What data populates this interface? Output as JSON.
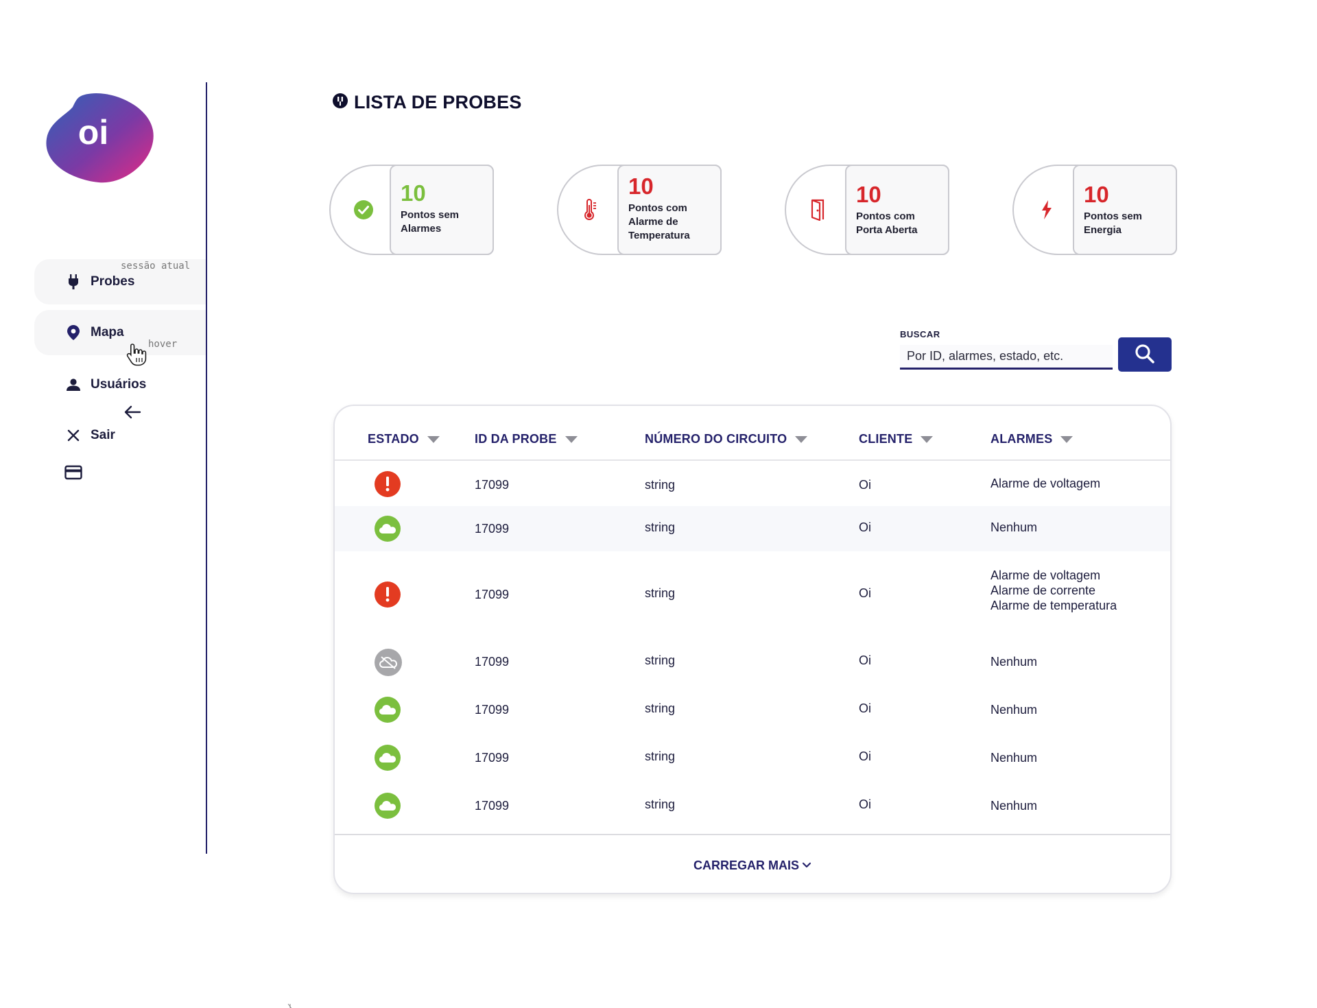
{
  "logo": {
    "text": "oi",
    "colors": [
      "#2f62b8",
      "#7b3aa5",
      "#e52a84"
    ]
  },
  "sidebar": {
    "current_session_note": "sessão atual",
    "hover_note": "hover",
    "items": [
      {
        "label": "Probes",
        "icon": "plug-icon"
      },
      {
        "label": "Mapa",
        "icon": "map-pin-icon"
      },
      {
        "label": "Usuários",
        "icon": "user-icon"
      },
      {
        "label": "Sair",
        "icon": "close-icon"
      }
    ]
  },
  "header": {
    "title": "LISTA DE PROBES",
    "icon": "probe-icon"
  },
  "stats": [
    {
      "value": "10",
      "label_lines": [
        "Pontos sem",
        "Alarmes"
      ],
      "color": "#7bbf3e",
      "icon": "check-circle-icon"
    },
    {
      "value": "10",
      "label_lines": [
        "Pontos com",
        "Alarme de",
        "Temperatura"
      ],
      "color": "#d7262b",
      "icon": "thermometer-icon"
    },
    {
      "value": "10",
      "label_lines": [
        "Pontos com",
        "Porta Aberta"
      ],
      "color": "#d7262b",
      "icon": "door-open-icon"
    },
    {
      "value": "10",
      "label_lines": [
        "Pontos sem",
        "Energia"
      ],
      "color": "#d7262b",
      "icon": "lightning-icon"
    }
  ],
  "search": {
    "label": "BUSCAR",
    "placeholder": "Por ID, alarmes, estado, etc."
  },
  "table": {
    "columns": [
      "ESTADO",
      "ID DA PROBE",
      "NÚMERO DO CIRCUITO",
      "CLIENTE",
      "ALARMES"
    ],
    "rows": [
      {
        "status": "alert",
        "id": "17099",
        "circuit": "string",
        "client": "Oi",
        "alarms": [
          "Alarme de voltagem"
        ]
      },
      {
        "status": "ok",
        "id": "17099",
        "circuit": "string",
        "client": "Oi",
        "alarms": [
          "Nenhum"
        ]
      },
      {
        "status": "alert",
        "id": "17099",
        "circuit": "string",
        "client": "Oi",
        "alarms": [
          "Alarme de voltagem",
          "Alarme de corrente",
          "Alarme de temperatura"
        ]
      },
      {
        "status": "offline",
        "id": "17099",
        "circuit": "string",
        "client": "Oi",
        "alarms": [
          "Nenhum"
        ]
      },
      {
        "status": "ok",
        "id": "17099",
        "circuit": "string",
        "client": "Oi",
        "alarms": [
          "Nenhum"
        ]
      },
      {
        "status": "ok",
        "id": "17099",
        "circuit": "string",
        "client": "Oi",
        "alarms": [
          "Nenhum"
        ]
      },
      {
        "status": "ok",
        "id": "17099",
        "circuit": "string",
        "client": "Oi",
        "alarms": [
          "Nenhum"
        ]
      }
    ],
    "load_more": "CARREGAR MAIS"
  },
  "colors": {
    "primary": "#24216a",
    "button": "#24318f",
    "ok": "#7bbf3e",
    "alert": "#e33b21",
    "offline": "#a7a7aa"
  }
}
